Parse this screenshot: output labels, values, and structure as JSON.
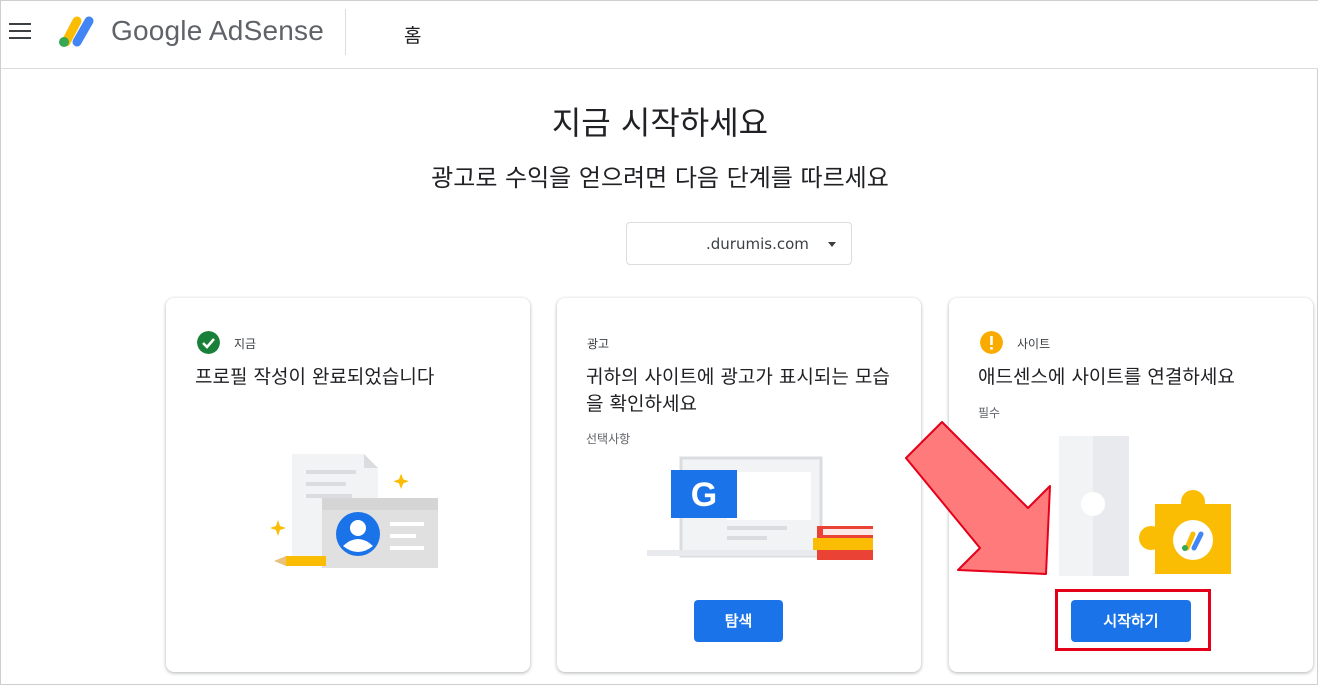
{
  "header": {
    "brand": "Google AdSense",
    "breadcrumb": "홈"
  },
  "hero": {
    "title": "지금 시작하세요",
    "subtitle": "광고로 수익을 얻으려면 다음 단계를 따르세요"
  },
  "site_selector": {
    "value": ".durumis.com"
  },
  "cards": [
    {
      "tag": "지금",
      "status": "complete",
      "title": "프로필 작성이 완료되었습니다"
    },
    {
      "tag": "광고",
      "title": "귀하의 사이트에 광고가 표시되는 모습을 확인하세요",
      "subtitle": "선택사항",
      "button": "탐색"
    },
    {
      "tag": "사이트",
      "status": "warning",
      "title": "애드센스에 사이트를 연결하세요",
      "subtitle": "필수",
      "button": "시작하기"
    }
  ],
  "colors": {
    "primary": "#1a73e8",
    "success": "#188038",
    "warning": "#f9ab00",
    "annotation": "#e4001b"
  },
  "icons": [
    "menu-icon",
    "adsense-logo-icon",
    "chevron-down-icon",
    "check-circle-icon",
    "exclamation-circle-icon"
  ]
}
